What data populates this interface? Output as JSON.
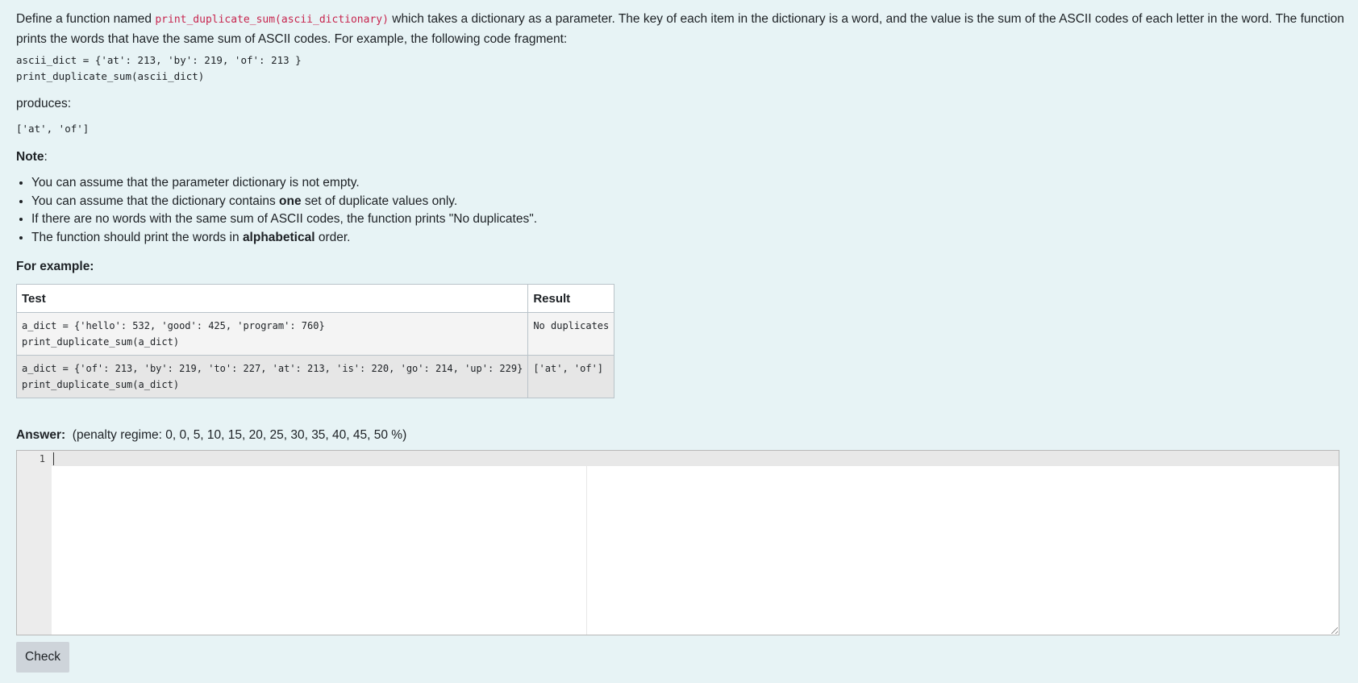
{
  "question": {
    "intro_before_code": "Define a function named ",
    "function_signature": "print_duplicate_sum(ascii_dictionary)",
    "intro_after_code": " which takes a dictionary as a parameter. The key of each item in the dictionary is a word, and the value is the sum of the ASCII codes of each letter in the word. The function prints the words that have the same sum of ASCII codes. For example, the following code fragment:",
    "example_code": "ascii_dict = {'at': 213, 'by': 219, 'of': 213 }\nprint_duplicate_sum(ascii_dict)",
    "produces_label": "produces:",
    "example_output": "['at', 'of']",
    "note_label": "Note",
    "note_colon": ":",
    "notes": [
      {
        "text": "You can assume that the parameter dictionary is not empty."
      },
      {
        "before": "You can assume that the dictionary contains ",
        "bold": "one",
        "after": " set of duplicate values only."
      },
      {
        "text": "If there are no words with the same sum of ASCII codes, the function prints \"No duplicates\"."
      },
      {
        "before": "The function should print the words in ",
        "bold": "alphabetical",
        "after": " order."
      }
    ],
    "for_example_label": "For example:"
  },
  "examples_table": {
    "headers": {
      "test": "Test",
      "result": "Result"
    },
    "rows": [
      {
        "test": "a_dict = {'hello': 532, 'good': 425, 'program': 760}\nprint_duplicate_sum(a_dict)",
        "result": "No duplicates"
      },
      {
        "test": "a_dict = {'of': 213, 'by': 219, 'to': 227, 'at': 213, 'is': 220, 'go': 214, 'up': 229}\nprint_duplicate_sum(a_dict)",
        "result": "['at', 'of']"
      }
    ]
  },
  "answer": {
    "label": "Answer:",
    "penalty": "(penalty regime: 0, 0, 5, 10, 15, 20, 25, 30, 35, 40, 45, 50 %)",
    "line_number": "1",
    "content": ""
  },
  "check_button": {
    "label": "Check"
  },
  "colors": {
    "panel_background": "#e7f3f5",
    "inline_code": "#c7254e",
    "button_background": "#ced4da"
  }
}
